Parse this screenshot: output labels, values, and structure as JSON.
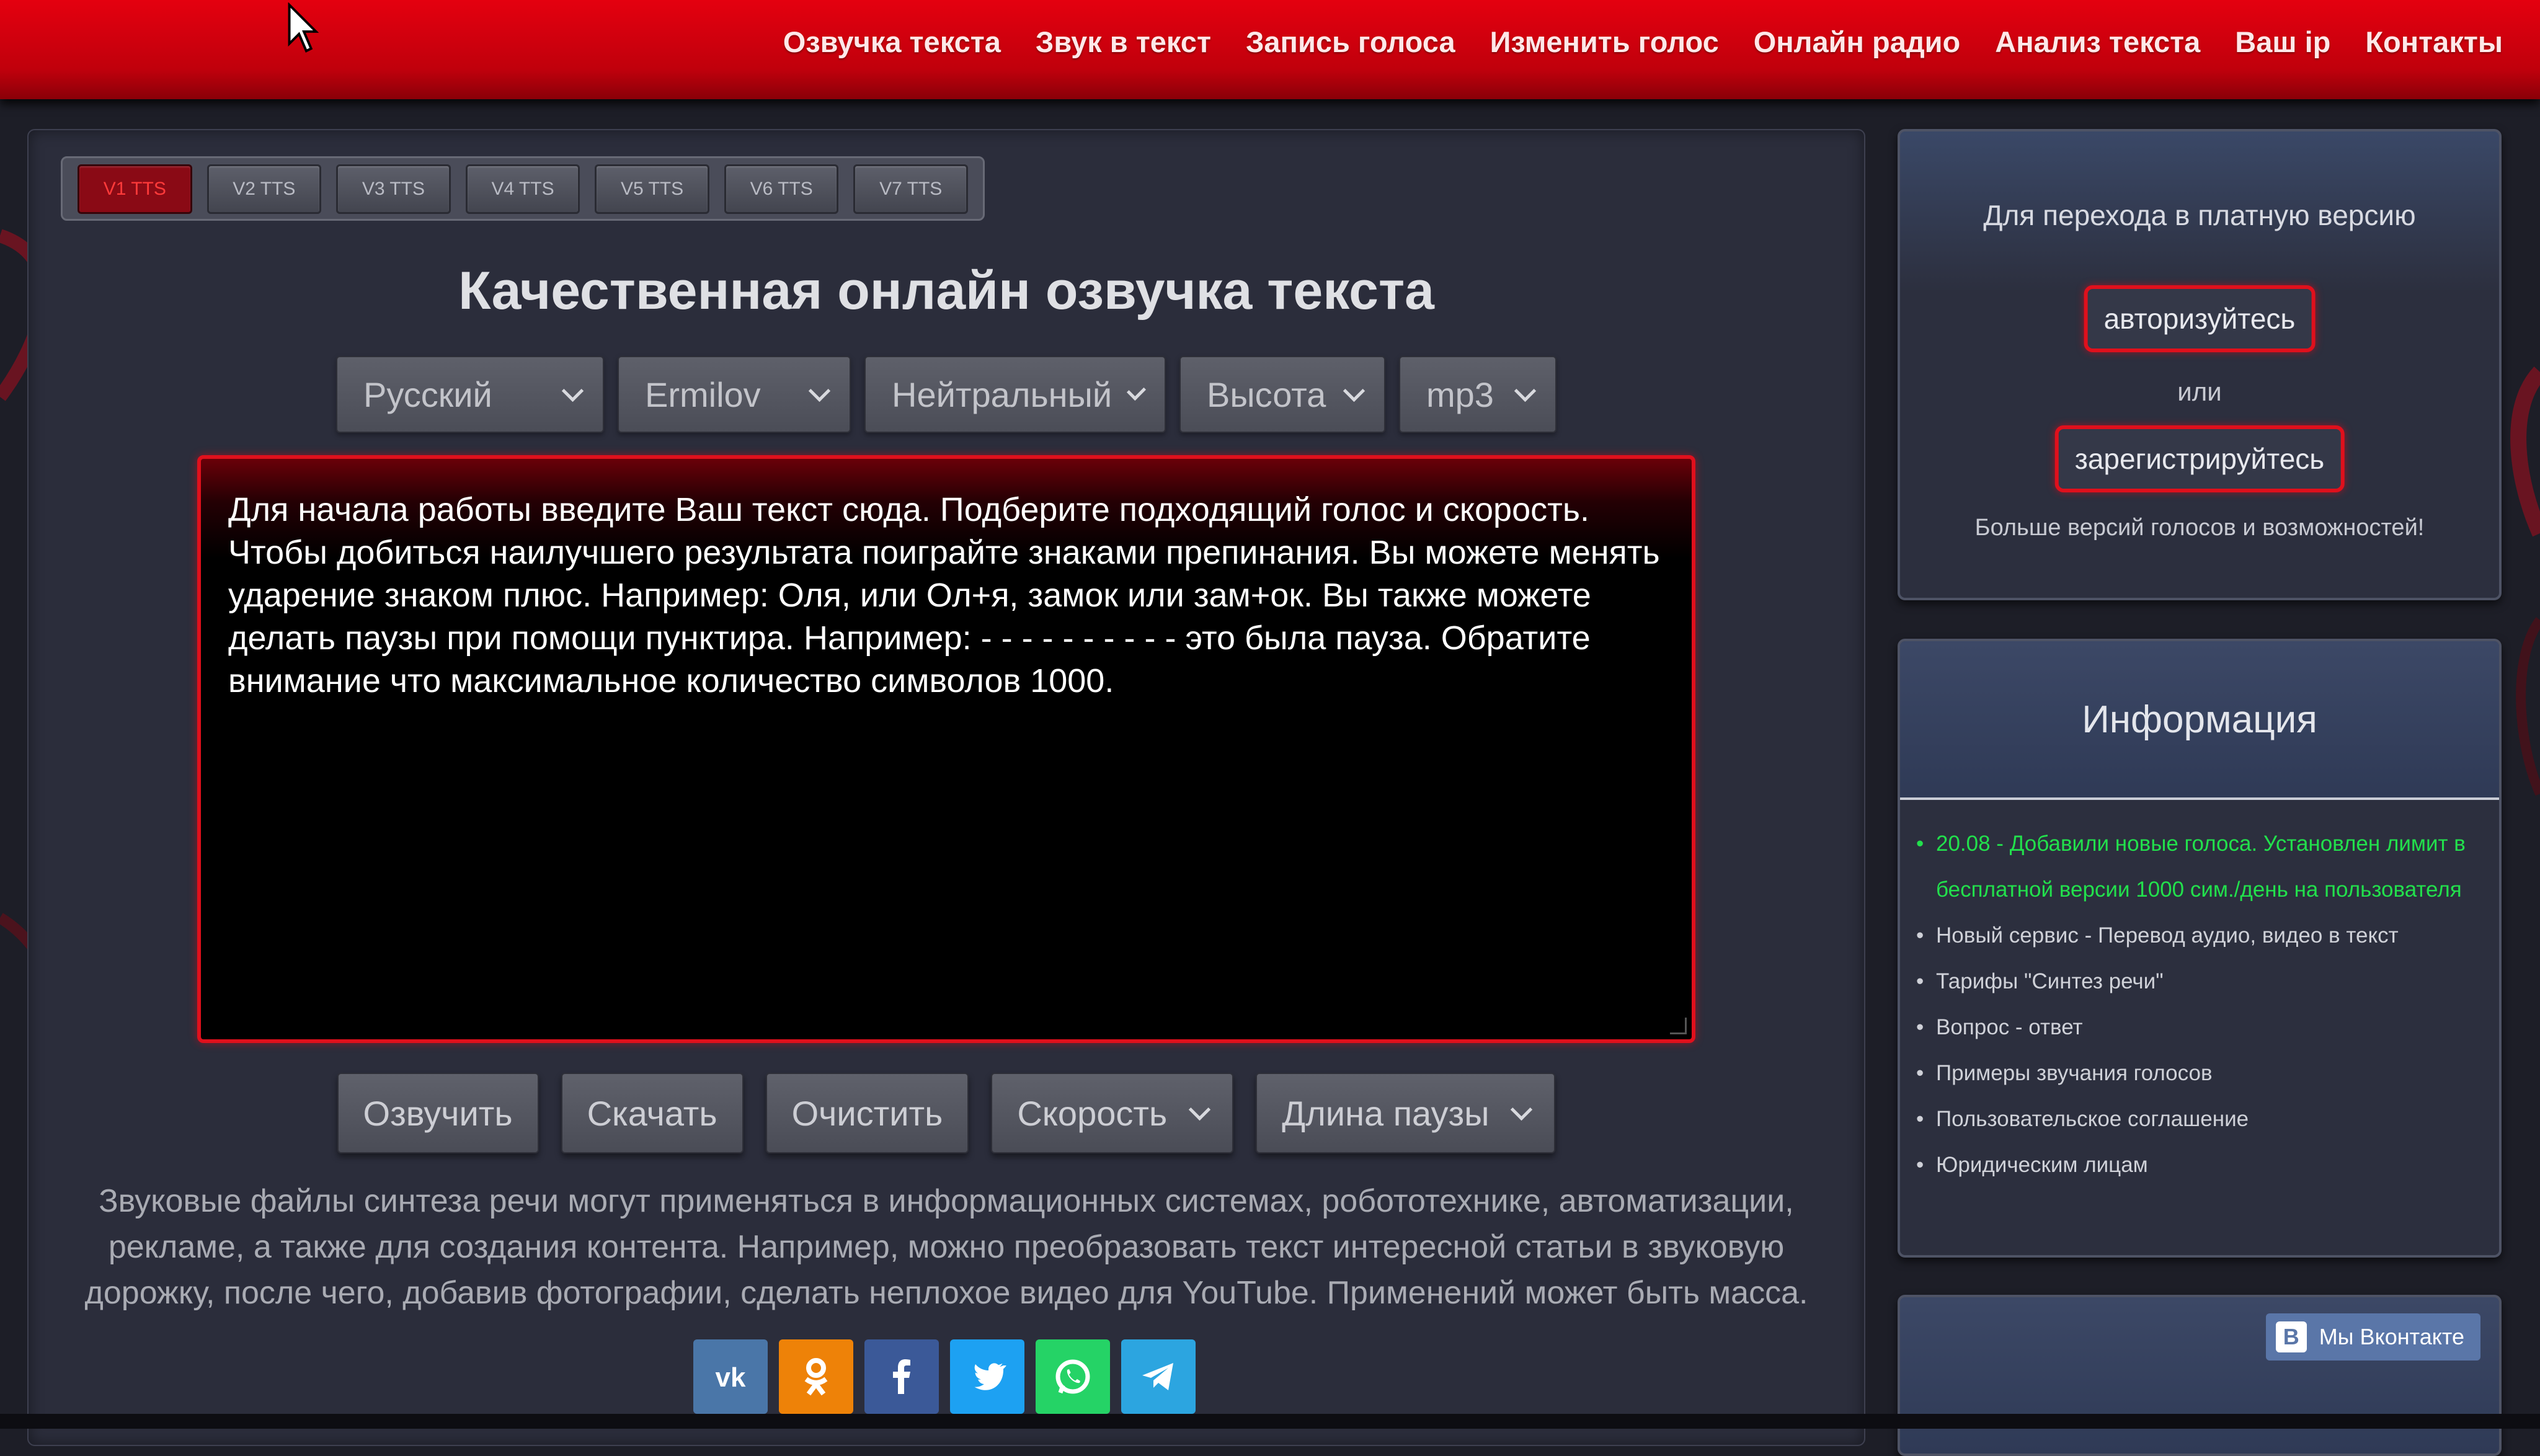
{
  "nav": {
    "items": [
      "Озвучка текста",
      "Звук в текст",
      "Запись голоса",
      "Изменить голос",
      "Онлайн радио",
      "Анализ текста",
      "Ваш ip",
      "Контакты"
    ]
  },
  "tts_tabs": [
    "V1 TTS",
    "V2 TTS",
    "V3 TTS",
    "V4 TTS",
    "V5 TTS",
    "V6 TTS",
    "V7 TTS"
  ],
  "main": {
    "title": "Качественная онлайн озвучка текста",
    "selects": {
      "language": "Русский",
      "voice": "Ermilov",
      "emotion": "Нейтральный",
      "pitch": "Высота",
      "format": "mp3"
    },
    "textarea_value": "Для начала работы введите Ваш текст сюда. Подберите подходящий голос и скорость. Чтобы добиться наилучшего результата поиграйте знаками препинания. Вы можете менять ударение знаком плюс. Например: Оля, или Ол+я, замок или зам+ок. Вы также можете делать паузы при помощи пунктира. Например: - - - - - - - - - - это была пауза. Обратите внимание что максимальное количество символов 1000.",
    "actions": {
      "speak": "Озвучить",
      "download": "Скачать",
      "clear": "Очистить",
      "speed": "Скорость",
      "pause_length": "Длина паузы"
    },
    "description": "Звуковые файлы синтеза речи могут применяться в информационных системах, робототехнике, автоматизации, рекламе, а также для создания контента. Например, можно преобразовать текст интересной статьи в звуковую дорожку, после чего, добавив фотографии, сделать неплохое видео для YouTube. Применений может быть масса."
  },
  "social": [
    {
      "icon": "vk-icon",
      "label": "VK",
      "color": "#4a76a8"
    },
    {
      "icon": "odnoklassniki-icon",
      "label": "OK",
      "color": "#ee8208"
    },
    {
      "icon": "facebook-icon",
      "label": "f",
      "color": "#3b5998"
    },
    {
      "icon": "twitter-icon",
      "label": "t",
      "color": "#1da1f2"
    },
    {
      "icon": "whatsapp-icon",
      "label": "w",
      "color": "#25d366"
    },
    {
      "icon": "telegram-icon",
      "label": "tg",
      "color": "#2ca5e0"
    }
  ],
  "sidebar": {
    "pay": {
      "line1": "Для перехода в платную версию",
      "login": "авторизуйтесь",
      "or": "или",
      "register": "зарегистрируйтесь",
      "more": "Больше версий голосов и возможностей!"
    },
    "info": {
      "title": "Информация",
      "items": [
        "20.08 - Добавили новые голоса. Установлен лимит в бесплатной версии 1000 сим./день на пользователя",
        "Новый сервис - Перевод аудио, видео в текст",
        "Тарифы \"Синтез речи\"",
        "Вопрос - ответ",
        "Примеры звучания голосов",
        "Пользовательское соглашение",
        "Юридическим лицам"
      ]
    },
    "vk": {
      "label": "Мы Вконтакте",
      "icon_letter": "B"
    }
  },
  "colors": {
    "accent_red": "#e0101c",
    "news_green": "#22e04c"
  }
}
